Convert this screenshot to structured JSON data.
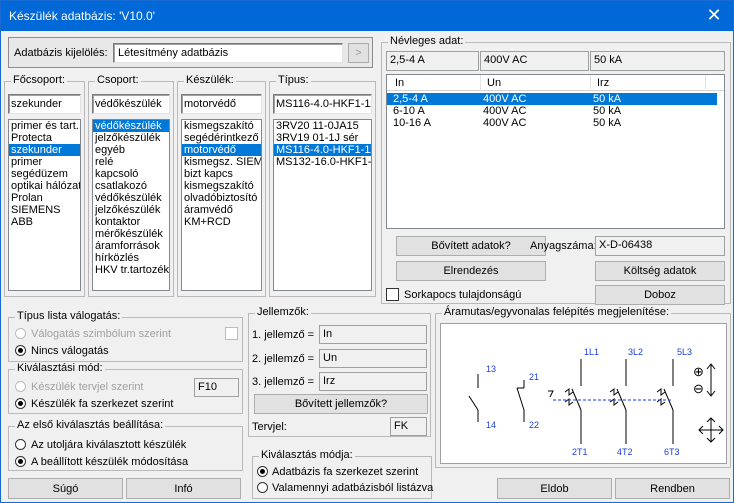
{
  "window": {
    "title": "Készülék adatbázis: 'V10.0'",
    "close_icon": "close-icon"
  },
  "db_select": {
    "label": "Adatbázis kijelölés:",
    "value": "Létesítmény adatbázis",
    "nav_button": ">"
  },
  "focsoport": {
    "label": "Főcsoport:",
    "value": "szekunder",
    "items": [
      "primer és tart.",
      "Protecta",
      "szekunder",
      "primer",
      "segédüzem",
      "optikai hálózat",
      "Prolan",
      "SIEMENS",
      "ABB"
    ],
    "selected": 2
  },
  "csoport": {
    "label": "Csoport:",
    "value": "védőkészülék",
    "items": [
      "védőkészülék",
      "jelzőkészülék",
      "egyéb",
      "relé",
      "kapcsoló",
      "csatlakozó",
      "védőkészülék",
      "jelzőkészülék",
      "kontaktor",
      "mérőkészülék",
      "áramforrások",
      "hírközlés",
      "HKV tr.tartozék"
    ],
    "selected": 0
  },
  "keszulek": {
    "label": "Készülék:",
    "value": "motorvédő",
    "items": [
      "kismegszakító",
      "segédérintkező",
      "motorvédő",
      "kismegsz. SIEM",
      "bizt kapcs",
      "kismegszakító",
      "olvadóbiztosító",
      "áramvédő",
      "KM+RCD"
    ],
    "selected": 2
  },
  "tipus": {
    "label": "Típus:",
    "value": "MS116-4.0-HKF1-11",
    "items": [
      "3RV20 11-0JA15",
      "3RV19 01-1J sér",
      "MS116-4.0-HKF1-11",
      "MS132-16.0-HKF1-11"
    ],
    "selected": 2
  },
  "nevleges": {
    "label": "Névleges adat:",
    "top": [
      "2,5-4 A",
      "400V AC",
      "50 kA"
    ],
    "headers": [
      "In",
      "Un",
      "Irz"
    ],
    "rows": [
      [
        "2,5-4 A",
        "400V AC",
        "50 kA"
      ],
      [
        "6-10 A",
        "400V AC",
        "50 kA"
      ],
      [
        "10-16 A",
        "400V AC",
        "50 kA"
      ]
    ],
    "selected": 0
  },
  "buttons": {
    "bovitett_adatok": "Bővített adatok?",
    "elrendezes": "Elrendezés",
    "koltseg": "Költség adatok",
    "doboz": "Doboz",
    "bovitett_jellemzok": "Bővített jellemzők?",
    "sugo": "Súgó",
    "info": "Infó",
    "eldob": "Eldob",
    "rendben": "Rendben"
  },
  "anyagszam": {
    "label": "Anyagszáma:",
    "value": "X-D-06438"
  },
  "sorkapocs": {
    "label": "Sorkapocs tulajdonságú"
  },
  "tipus_lista": {
    "label": "Típus lista válogatás:",
    "opt1": "Válogatás szimbólum szerint",
    "opt2": "Nincs válogatás"
  },
  "kivalasztasi_mod": {
    "label": "Kiválasztási mód:",
    "opt1": "Készülék tervjel szerint",
    "opt2": "Készülék fa szerkezet szerint",
    "field": "F10"
  },
  "elso_kivalasztas": {
    "label": "Az első kiválasztás beállítása:",
    "opt1": "Az utoljára kiválasztott készülék",
    "opt2": "A beállított készülék módosítása"
  },
  "jellemzok": {
    "label": "Jellemzők:",
    "rows": [
      {
        "label": "1. jellemző =",
        "value": "In"
      },
      {
        "label": "2. jellemző =",
        "value": "Un"
      },
      {
        "label": "3. jellemző =",
        "value": "Irz"
      }
    ],
    "tervjel_label": "Tervjel:",
    "tervjel_value": "FK"
  },
  "kivalasztas_modja": {
    "label": "Kiválasztás módja:",
    "opt1": "Adatbázis fa szerkezet szerint",
    "opt2": "Valamennyi adatbázisból listázva"
  },
  "aramutas": {
    "label": "Áramutas/egyvonalas felépítés megjelenítése:",
    "terms": [
      "13",
      "14",
      "21",
      "22",
      "1L1",
      "2T1",
      "3L2",
      "4T2",
      "5L3",
      "6T3"
    ],
    "zoom_in": "⊕",
    "zoom_out": "⊖"
  },
  "colors": {
    "title_bar": "#0068d7",
    "selection": "#0078d7",
    "diagram_blue": "#1a3fd8"
  }
}
